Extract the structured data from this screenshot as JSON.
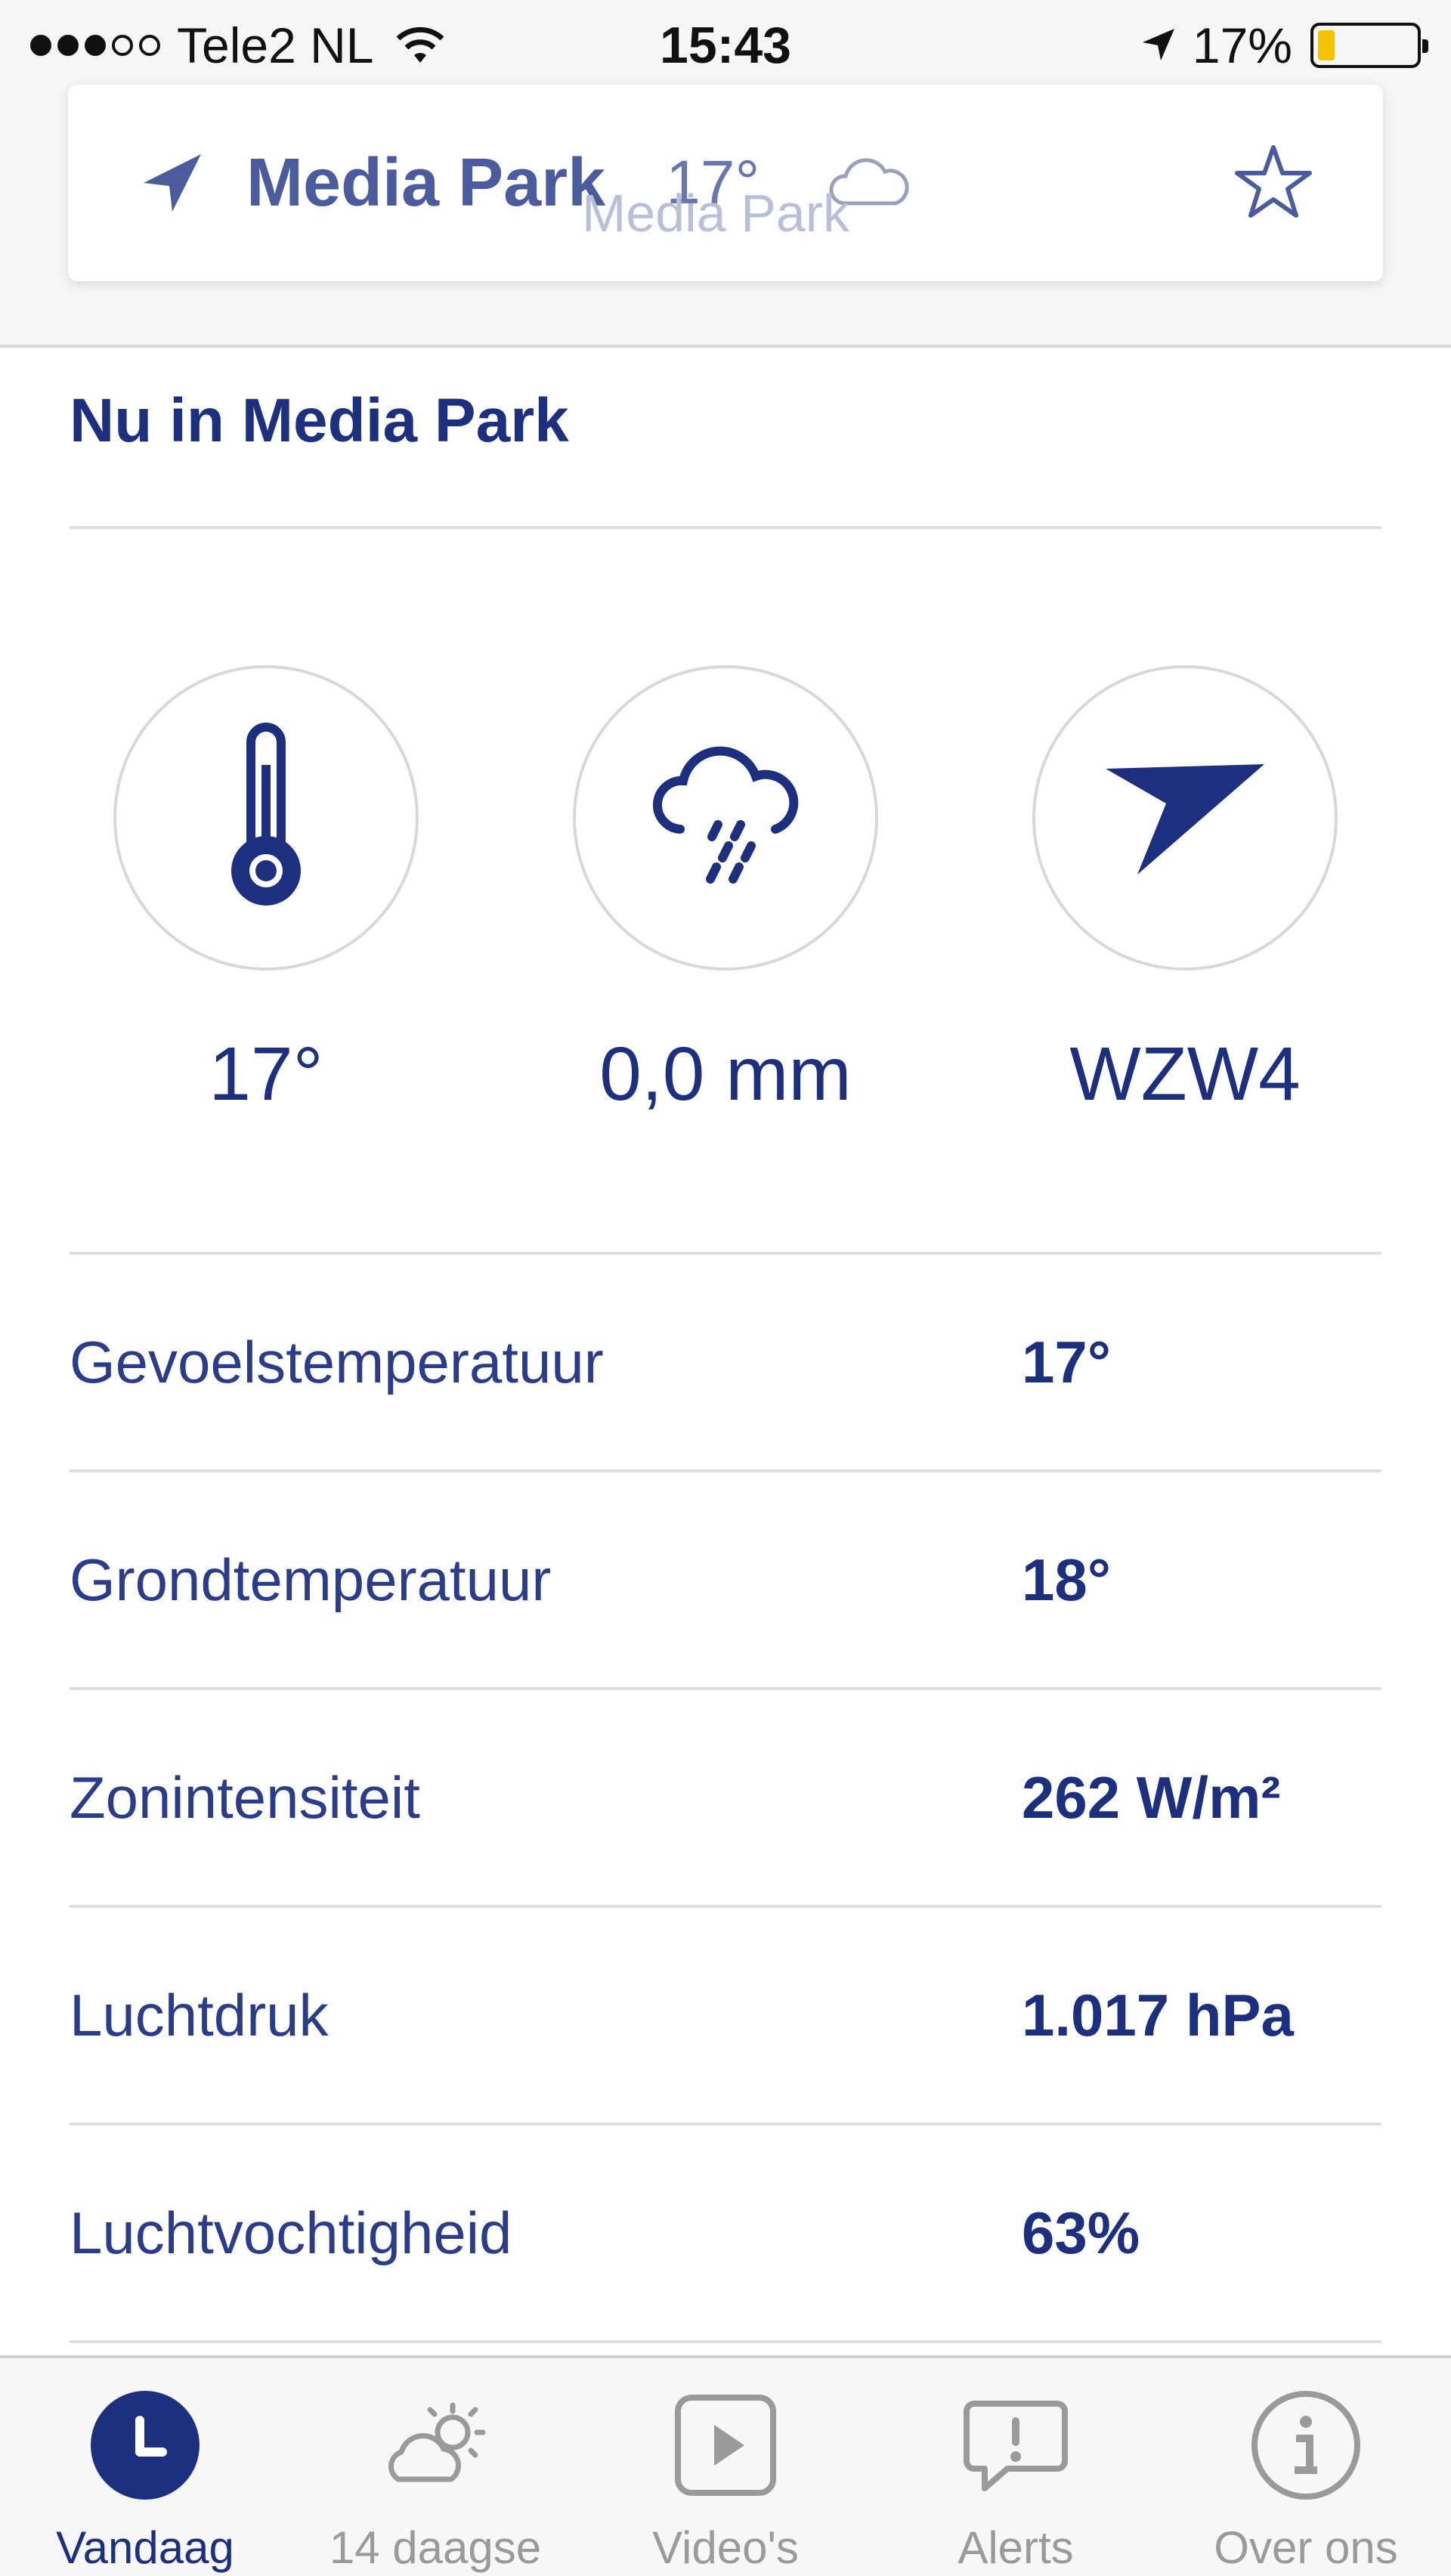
{
  "status_bar": {
    "carrier": "Tele2 NL",
    "time": "15:43",
    "battery": "17%",
    "battery_level": 0.17
  },
  "location_card": {
    "name": "Media Park",
    "temperature": "17°",
    "subtitle": "Media Park",
    "weather_icon": "cloud-icon",
    "favorite_icon": "star-icon"
  },
  "main": {
    "title": "Nu in Media Park",
    "metrics": [
      {
        "icon": "thermometer-icon",
        "value": "17°"
      },
      {
        "icon": "rain-cloud-icon",
        "value": "0,0 mm"
      },
      {
        "icon": "wind-direction-icon",
        "value": "WZW4"
      }
    ],
    "details": [
      {
        "label": "Gevoelstemperatuur",
        "value": "17°"
      },
      {
        "label": "Grondtemperatuur",
        "value": "18°"
      },
      {
        "label": "Zonintensiteit",
        "value": "262 W/m²"
      },
      {
        "label": "Luchtdruk",
        "value": "1.017 hPa"
      },
      {
        "label": "Luchtvochtigheid",
        "value": "63%"
      }
    ]
  },
  "tabs": [
    {
      "label": "Vandaag",
      "icon": "clock-icon",
      "active": true
    },
    {
      "label": "14 daagse",
      "icon": "partly-sunny-icon",
      "active": false
    },
    {
      "label": "Video's",
      "icon": "play-icon",
      "active": false
    },
    {
      "label": "Alerts",
      "icon": "alert-bubble-icon",
      "active": false
    },
    {
      "label": "Over ons",
      "icon": "info-icon",
      "active": false
    }
  ],
  "colors": {
    "primary": "#1d2f7f",
    "card_text": "#4a5b9e",
    "inactive": "#9a9a9a",
    "battery": "#f5c400"
  }
}
